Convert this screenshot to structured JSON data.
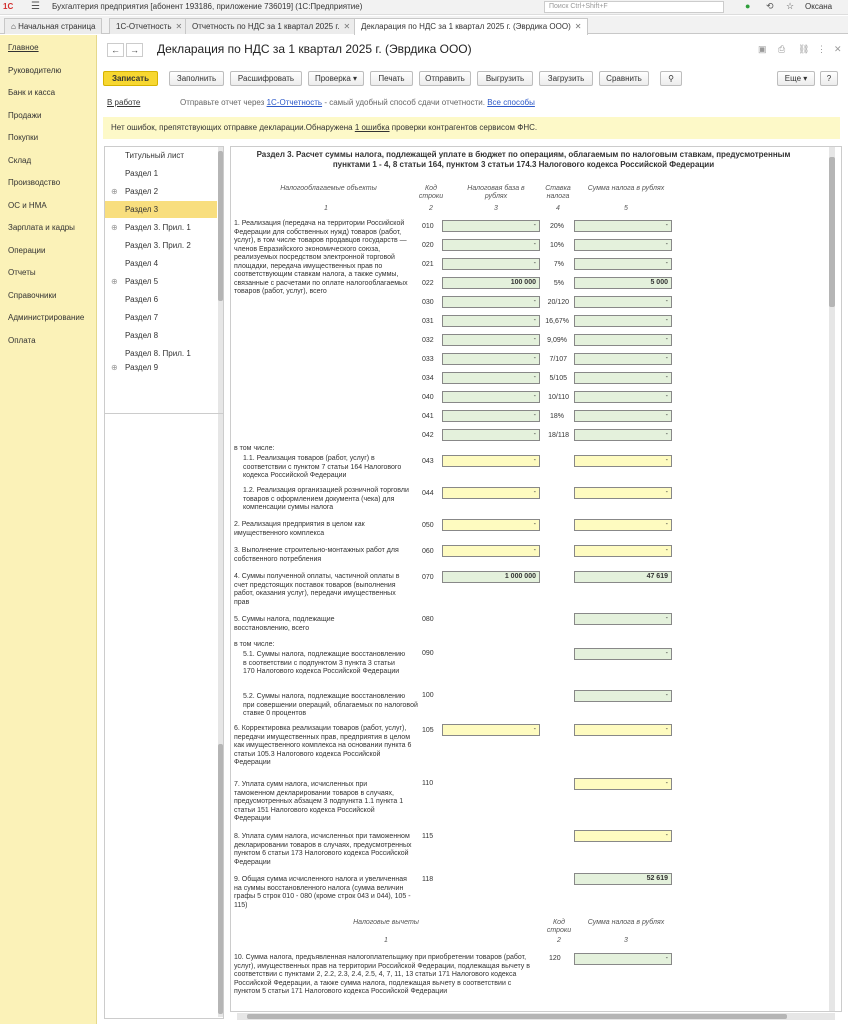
{
  "app": {
    "logo": "1С",
    "title": "Бухгалтерия предприятия [абонент 193186, приложение 736019] (1С:Предприятие)",
    "search_placeholder": "Поиск Ctrl+Shift+F",
    "user": "Оксана"
  },
  "tabs": [
    {
      "label": "Начальная страница"
    },
    {
      "label": "1С-Отчетность"
    },
    {
      "label": "Отчетность по НДС за 1 квартал 2025 г."
    },
    {
      "label": "Декларация по НДС за 1 квартал 2025 г. (Эврдика ООО)"
    }
  ],
  "sidebar": [
    "Главное",
    "Руководителю",
    "Банк и касса",
    "Продажи",
    "Покупки",
    "Склад",
    "Производство",
    "ОС и НМА",
    "Зарплата и кадры",
    "Операции",
    "Отчеты",
    "Справочники",
    "Администрирование",
    "Оплата"
  ],
  "document": {
    "title": "Декларация по НДС за 1 квартал 2025 г. (Эврдика ООО)"
  },
  "toolbar": {
    "save": "Записать",
    "fill": "Заполнить",
    "decode": "Расшифровать",
    "check": "Проверка",
    "print": "Печать",
    "send": "Отправить",
    "export": "Выгрузить",
    "import": "Загрузить",
    "compare": "Сравнить",
    "more": "Еще",
    "help": "?"
  },
  "status": {
    "state": "В работе",
    "text": "Отправьте отчет через",
    "link": "1С-Отчетность",
    "text2": "- самый удобный способ сдачи отчетности.",
    "all_methods": "Все способы"
  },
  "info": {
    "text": "Нет ошибок, препятствующих отправке декларации.Обнаружена",
    "link": "1 ошибка",
    "text2": "проверки контрагентов сервисом ФНС."
  },
  "tree": [
    "Титульный лист",
    "Раздел 1",
    "Раздел 2",
    "Раздел 3",
    "Раздел 3. Прил. 1",
    "Раздел 3. Прил. 2",
    "Раздел 4",
    "Раздел 5",
    "Раздел 6",
    "Раздел 7",
    "Раздел 8",
    "Раздел 8. Прил. 1",
    "Раздел 9"
  ],
  "form": {
    "section_title": "Раздел 3. Расчет суммы налога, подлежащей уплате в бюджет по операциям, облагаемым по налоговым ставкам, предусмотренным пунктами 1 - 4, 8 статьи 164, пунктом 3 статьи 174.3 Налогового кодекса Российской Федерации",
    "col_objects": "Налогооблагаемые объекты",
    "col_code": "Код строки",
    "col_base": "Налоговая база в рублях",
    "col_rate": "Ставка налога",
    "col_tax": "Сумма налога в рублях",
    "n1": "1",
    "n2": "2",
    "n3": "3",
    "n4": "4",
    "n5": "5",
    "item1": "1. Реализация (передача на территории Российской Федерации для собственных нужд) товаров (работ, услуг), в том числе товаров продавцов государств — членов Евразийского экономического союза, реализуемых посредством электронной торговой площадки, передача имущественных прав по соответствующим ставкам налога, а также суммы, связанные с расчетами по оплате налогооблагаемых товаров (работ, услуг), всего",
    "rows1": [
      {
        "code": "010",
        "rate": "20%",
        "base": "-",
        "tax": "-"
      },
      {
        "code": "020",
        "rate": "10%",
        "base": "-",
        "tax": "-"
      },
      {
        "code": "021",
        "rate": "7%",
        "base": "-",
        "tax": "-"
      },
      {
        "code": "022",
        "rate": "5%",
        "base": "100 000",
        "tax": "5 000"
      },
      {
        "code": "030",
        "rate": "20/120",
        "base": "-",
        "tax": "-"
      },
      {
        "code": "031",
        "rate": "16,67%",
        "base": "-",
        "tax": "-"
      },
      {
        "code": "032",
        "rate": "9,09%",
        "base": "-",
        "tax": "-"
      },
      {
        "code": "033",
        "rate": "7/107",
        "base": "-",
        "tax": "-"
      },
      {
        "code": "034",
        "rate": "5/105",
        "base": "-",
        "tax": "-"
      },
      {
        "code": "040",
        "rate": "10/110",
        "base": "-",
        "tax": "-"
      },
      {
        "code": "041",
        "rate": "18%",
        "base": "-",
        "tax": "-"
      },
      {
        "code": "042",
        "rate": "18/118",
        "base": "-",
        "tax": "-"
      }
    ],
    "incl": "в том числе:",
    "item11": "1.1. Реализация товаров (работ, услуг) в соответствии с пунктом 7 статьи 164 Налогового кодекса Российской Федерации",
    "code043": "043",
    "v043b": "-",
    "v043t": "-",
    "item12": "1.2. Реализация организацией розничной торговли товаров с оформлением документа (чека) для компенсации суммы налога",
    "code044": "044",
    "v044b": "-",
    "v044t": "-",
    "item2": "2. Реализация предприятия в целом как имущественного комплекса",
    "code050": "050",
    "v050b": "-",
    "v050t": "-",
    "item3": "3. Выполнение строительно-монтажных работ для собственного потребления",
    "code060": "060",
    "v060b": "-",
    "v060t": "-",
    "item4": "4. Суммы полученной оплаты, частичной оплаты в счет предстоящих поставок товаров (выполнения работ, оказания услуг), передачи имущественных прав",
    "code070": "070",
    "v070b": "1 000 000",
    "v070t": "47 619",
    "item5": "5. Суммы налога, подлежащие восстановлению, всего",
    "code080": "080",
    "v080t": "-",
    "incl2": "в том числе:",
    "item51": "5.1. Суммы налога, подлежащие восстановлению в соответствии с подпунктом 3 пункта 3 статьи 170 Налогового кодекса Российской Федерации",
    "code090": "090",
    "v090t": "-",
    "item52": "5.2. Суммы налога, подлежащие восстановлению при совершении операций, облагаемых по налоговой ставке 0 процентов",
    "code100": "100",
    "v100t": "-",
    "item6": "6. Корректировка реализации товаров (работ, услуг), передачи имущественных прав, предприятия в целом как имущественного комплекса на основании пункта 6 статьи 105.3 Налогового кодекса Российской Федерации",
    "code105": "105",
    "v105b": "-",
    "v105t": "-",
    "item7": "7. Уплата сумм налога, исчисленных при таможенном декларировании товаров в случаях, предусмотренных абзацем 3 подпункта 1.1 пункта 1 статьи 151 Налогового кодекса Российской Федерации",
    "code110": "110",
    "v110t": "-",
    "item8": "8. Уплата сумм налога, исчисленных при таможенном декларировании товаров в случаях, предусмотренных пунктом 6 статьи 173 Налогового кодекса Российской Федерации",
    "code115": "115",
    "v115t": "-",
    "item9": "9. Общая сумма исчисленного налога и увеличенная на суммы восстановленного налога (сумма величин графы 5 строк 010 - 080 (кроме строк 043 и 044), 105 - 115)",
    "code118": "118",
    "v118t": "52 619",
    "col_deduct": "Налоговые вычеты",
    "col_code2": "Код строки",
    "col_tax2": "Сумма налога в рублях",
    "m1": "1",
    "m2": "2",
    "m3": "3",
    "item10": "10. Сумма налога, предъявленная налогоплательщику при приобретении товаров (работ, услуг), имущественных прав на территории Российской Федерации, подлежащая вычету в соответствии с пунктами 2, 2.2, 2.3, 2.4, 2.5, 4, 7, 11, 13 статьи 171 Налогового кодекса Российской Федерации, а также сумма налога, подлежащая вычету в соответствии с пунктом 5 статьи 171 Налогового кодекса Российской Федерации",
    "code120": "120",
    "v120t": "-"
  }
}
